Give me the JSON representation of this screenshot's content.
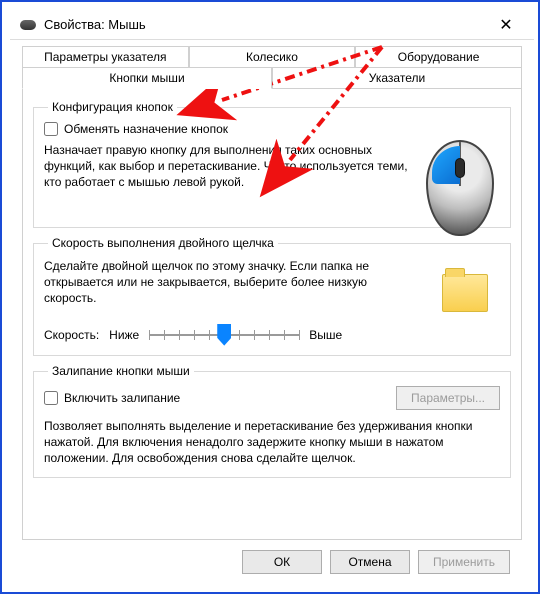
{
  "window": {
    "title": "Свойства: Мышь"
  },
  "tabs": {
    "row1": [
      {
        "label": "Параметры указателя"
      },
      {
        "label": "Колесико"
      },
      {
        "label": "Оборудование"
      }
    ],
    "row2": [
      {
        "label": "Кнопки мыши",
        "active": true
      },
      {
        "label": "Указатели"
      }
    ]
  },
  "group_buttons": {
    "legend": "Конфигурация кнопок",
    "swap_label": "Обменять назначение кнопок",
    "swap_checked": false,
    "desc": "Назначает правую кнопку для выполнения таких основных функций, как выбор и перетаскивание. Часто используется теми, кто работает с мышью левой рукой."
  },
  "group_dblclick": {
    "legend": "Скорость выполнения двойного щелчка",
    "desc": "Сделайте двойной щелчок по этому значку. Если папка не открывается или не закрывается, выберите более низкую скорость.",
    "speed_label": "Скорость:",
    "slow_label": "Ниже",
    "fast_label": "Выше",
    "slider": {
      "min": 0,
      "max": 10,
      "value": 5
    }
  },
  "group_clicklock": {
    "legend": "Залипание кнопки мыши",
    "enable_label": "Включить залипание",
    "enable_checked": false,
    "settings_label": "Параметры...",
    "settings_enabled": false,
    "desc": "Позволяет выполнять выделение и перетаскивание без удерживания кнопки нажатой. Для включения ненадолго задержите кнопку мыши в нажатом положении. Для освобождения снова сделайте щелчок."
  },
  "dialog_buttons": {
    "ok": "ОК",
    "cancel": "Отмена",
    "apply": "Применить",
    "apply_enabled": false
  }
}
